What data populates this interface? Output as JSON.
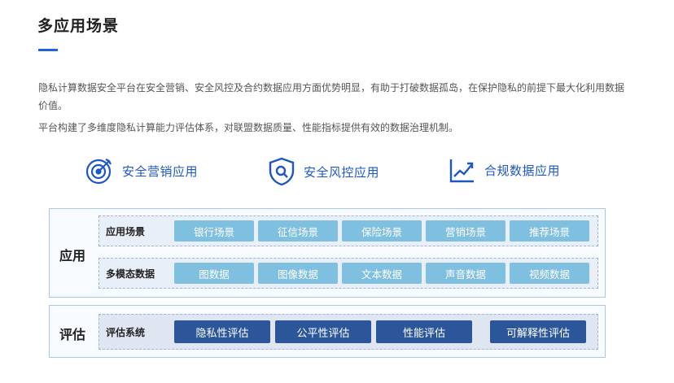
{
  "section": {
    "title": "多应用场景",
    "paragraphs": [
      "隐私计算数据安全平台在安全营销、安全风控及合约数据应用方面优势明显，有助于打破数据孤岛，在保护隐私的前提下最大化利用数据价值。",
      "平台构建了多维度隐私计算能力评估体系，对联盟数据质量、性能指标提供有效的数据治理机制。"
    ]
  },
  "features": [
    {
      "label": "安全营销应用",
      "icon": "target-icon"
    },
    {
      "label": "安全风控应用",
      "icon": "shield-search-icon"
    },
    {
      "label": "合规数据应用",
      "icon": "trend-chart-icon"
    }
  ],
  "colors": {
    "accent": "#1f63e0",
    "feature_text": "#1d56c9",
    "chip_light": "#7fbfe0",
    "chip_dark": "#2d569a",
    "panel_border": "#a9c8e6"
  },
  "application": {
    "label": "应用",
    "rows": [
      {
        "label": "应用场景",
        "items": [
          "银行场景",
          "征信场景",
          "保险场景",
          "营销场景",
          "推荐场景"
        ]
      },
      {
        "label": "多模态数据",
        "items": [
          "图数据",
          "图像数据",
          "文本数据",
          "声音数据",
          "视频数据"
        ]
      }
    ]
  },
  "evaluation": {
    "label": "评估",
    "row": {
      "label": "评估系统",
      "items": [
        "隐私性评估",
        "公平性评估",
        "性能评估",
        "可解释性评估"
      ]
    }
  }
}
